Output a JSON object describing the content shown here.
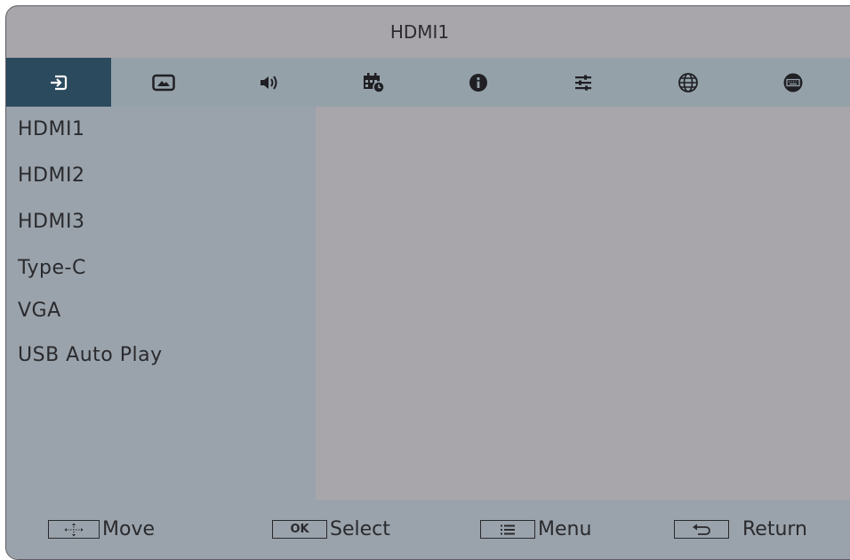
{
  "header": {
    "title": "HDMI1"
  },
  "tabs": [
    {
      "icon": "input-source-icon",
      "active": true
    },
    {
      "icon": "picture-icon",
      "active": false
    },
    {
      "icon": "volume-icon",
      "active": false
    },
    {
      "icon": "schedule-icon",
      "active": false
    },
    {
      "icon": "info-icon",
      "active": false
    },
    {
      "icon": "adjust-icon",
      "active": false
    },
    {
      "icon": "language-icon",
      "active": false
    },
    {
      "icon": "keyboard-icon",
      "active": false
    }
  ],
  "sources": [
    {
      "label": "HDMI1"
    },
    {
      "label": "HDMI2"
    },
    {
      "label": "HDMI3"
    },
    {
      "label": "Type-C"
    },
    {
      "label": "VGA"
    },
    {
      "label": "USB Auto Play"
    }
  ],
  "footer": {
    "move_label": "Move",
    "ok_key": "OK",
    "select_label": "Select",
    "menu_label": "Menu",
    "return_label": "Return"
  },
  "colors": {
    "background": "#a9a6ab",
    "tab_bar": "#95a1a9",
    "active_tab": "#2b4a5d",
    "sidebar": "#9aa3ab",
    "text": "#2a2a2e"
  }
}
